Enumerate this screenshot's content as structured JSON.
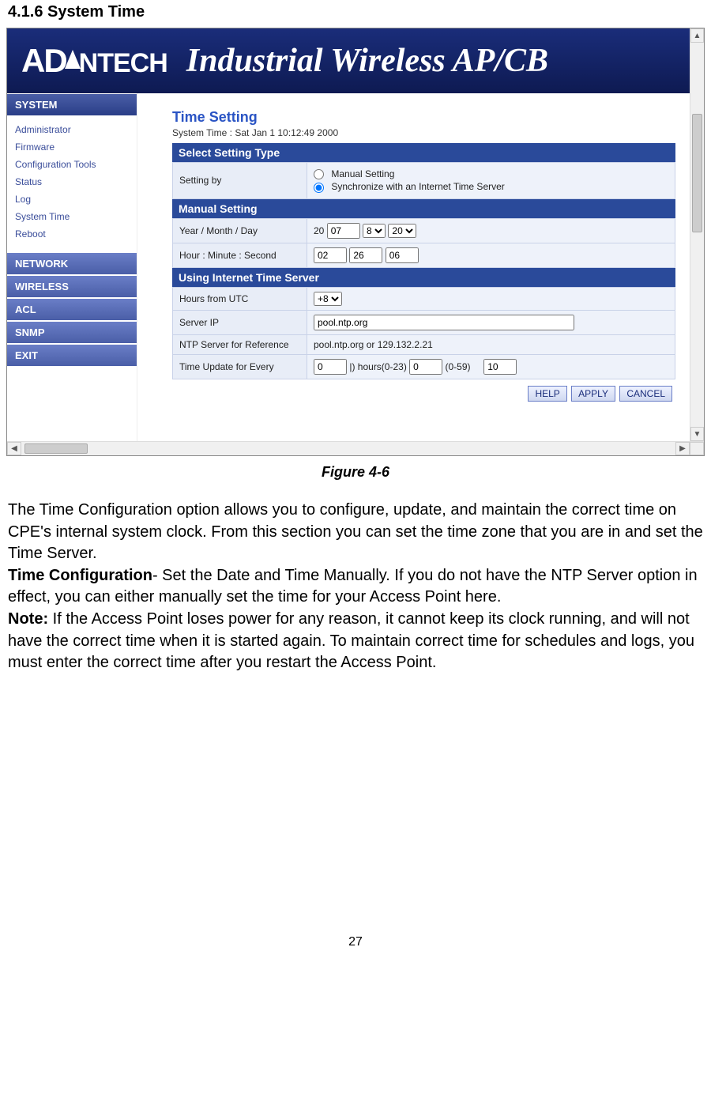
{
  "doc": {
    "heading": "4.1.6  System Time",
    "figure_caption": "Figure 4-6",
    "para1": "The Time Configuration option allows you to configure, update, and maintain the correct time on CPE's internal system clock. From this section you can set the time zone that you are in and set the Time Server.",
    "para2_bold": "Time Configuration",
    "para2_rest": "- Set the Date and Time Manually. If you do not have the NTP Server option in effect, you can either manually set the time for your Access Point here.",
    "para3_bold": "Note:",
    "para3_rest": " If the Access Point loses power for any reason, it cannot keep its clock running, and will not have the correct time when it is started again. To maintain correct time for schedules and logs, you must enter the correct time after you restart the Access Point.",
    "page_number": "27"
  },
  "banner": {
    "logo_a": "AD",
    "logo_rest": "NTECH",
    "title": "Industrial Wireless AP/CB"
  },
  "sidebar": {
    "top_header": "SYSTEM",
    "items": [
      "Administrator",
      "Firmware",
      "Configuration Tools",
      "Status",
      "Log",
      "System Time",
      "Reboot"
    ],
    "sections": [
      "NETWORK",
      "WIRELESS",
      "ACL",
      "SNMP",
      "EXIT"
    ]
  },
  "panel": {
    "title": "Time Setting",
    "system_time_label": "System Time : Sat Jan 1 10:12:49 2000",
    "section1": "Select Setting Type",
    "setting_by_label": "Setting by",
    "radio_manual": "Manual Setting",
    "radio_sync": "Synchronize with an Internet Time Server",
    "section2": "Manual Setting",
    "ymd_label": "Year / Month / Day",
    "ymd_year_prefix": "20",
    "ymd_year": "07",
    "ymd_month": "8",
    "ymd_day": "20",
    "hms_label": "Hour : Minute : Second",
    "hms_hour": "02",
    "hms_min": "26",
    "hms_sec": "06",
    "section3": "Using Internet Time Server",
    "utc_label": "Hours from UTC",
    "utc_value": "+8",
    "serverip_label": "Server IP",
    "serverip_value": "pool.ntp.org",
    "ntp_ref_label": "NTP Server for Reference",
    "ntp_ref_value": "pool.ntp.org or 129.132.2.21",
    "update_label": "Time Update for Every",
    "update_hours": "0",
    "update_hours_text": "|)  hours(0-23)",
    "update_min": "0",
    "update_min_text": "(0-59)",
    "update_last": "10",
    "buttons": {
      "help": "HELP",
      "apply": "APPLY",
      "cancel": "CANCEL"
    }
  }
}
